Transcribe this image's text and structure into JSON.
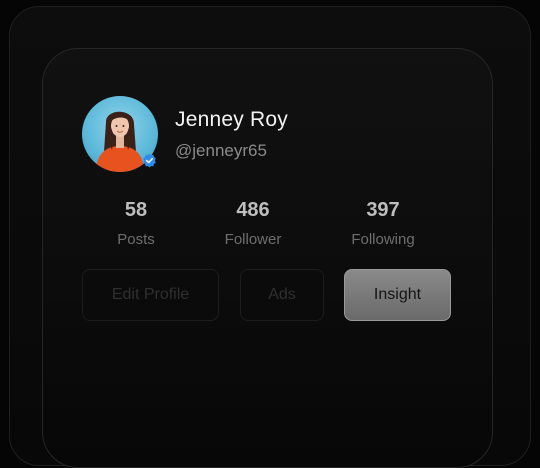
{
  "profile": {
    "name": "Jenney Roy",
    "handle": "@jenneyr65"
  },
  "stats": [
    {
      "value": "58",
      "label": "Posts"
    },
    {
      "value": "486",
      "label": "Follower"
    },
    {
      "value": "397",
      "label": "Following"
    }
  ],
  "actions": {
    "edit_profile": "Edit Profile",
    "ads": "Ads",
    "insight": "Insight"
  },
  "colors": {
    "verified_badge": "#2e8be8",
    "background": "#050505"
  }
}
